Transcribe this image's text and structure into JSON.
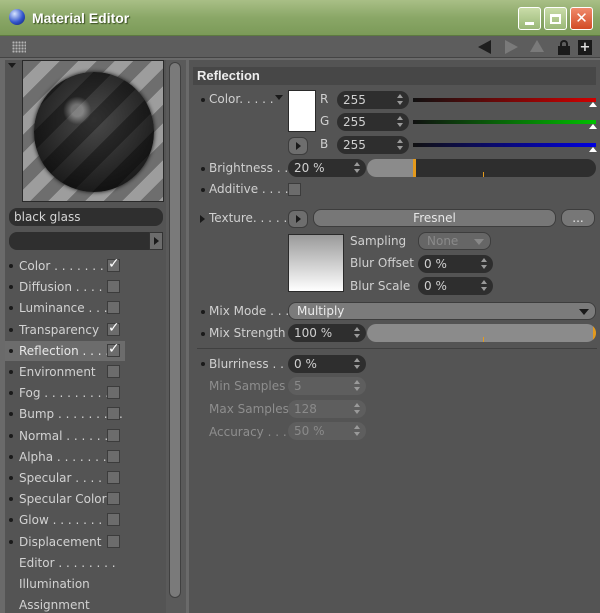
{
  "window": {
    "title": "Material Editor"
  },
  "channels": [
    {
      "label": "Color . . . . . . . .",
      "checkbox": true,
      "checked": true,
      "dot": true
    },
    {
      "label": "Diffusion . . . . . .",
      "checkbox": true,
      "checked": false,
      "dot": true
    },
    {
      "label": "Luminance . . . .",
      "checkbox": true,
      "checked": false,
      "dot": true
    },
    {
      "label": "Transparency",
      "checkbox": true,
      "checked": true,
      "dot": true
    },
    {
      "label": "Reflection . . . . .",
      "checkbox": true,
      "checked": true,
      "dot": true,
      "active": true
    },
    {
      "label": "Environment",
      "checkbox": true,
      "checked": false,
      "dot": true
    },
    {
      "label": "Fog . . . . . . . . . .",
      "checkbox": true,
      "checked": false,
      "dot": true
    },
    {
      "label": "Bump . . . . . . . . .",
      "checkbox": true,
      "checked": false,
      "dot": true
    },
    {
      "label": "Normal . . . . . . .",
      "checkbox": true,
      "checked": false,
      "dot": true
    },
    {
      "label": "Alpha . . . . . . . .",
      "checkbox": true,
      "checked": false,
      "dot": true
    },
    {
      "label": "Specular . . . . .",
      "checkbox": true,
      "checked": false,
      "dot": true
    },
    {
      "label": "Specular Color",
      "checkbox": true,
      "checked": false,
      "dot": true
    },
    {
      "label": "Glow . . . . . . . . .",
      "checkbox": true,
      "checked": false,
      "dot": true
    },
    {
      "label": "Displacement",
      "checkbox": true,
      "checked": false,
      "dot": true
    },
    {
      "label": "Editor . . . . . . . .",
      "checkbox": false,
      "checked": false,
      "dot": false
    },
    {
      "label": "Illumination",
      "checkbox": false,
      "checked": false,
      "dot": false
    },
    {
      "label": "Assignment",
      "checkbox": false,
      "checked": false,
      "dot": false
    }
  ],
  "material_name": "black glass",
  "reflection": {
    "header": "Reflection",
    "color_label": "Color. . . . .",
    "r_label": "R",
    "g_label": "G",
    "b_label": "B",
    "r_value": "255",
    "g_value": "255",
    "b_value": "255",
    "brightness_label": "Brightness . .",
    "brightness_value": "20 %",
    "brightness_level": 0.2,
    "additive_label": "Additive . . . .",
    "texture_label": "Texture. . . . .",
    "texture_name": "Fresnel",
    "more_label": "...",
    "sampling_label": "Sampling",
    "sampling_value": "None",
    "blur_offset_label": "Blur Offset",
    "blur_offset_value": "0 %",
    "blur_scale_label": "Blur Scale",
    "blur_scale_value": "0 %",
    "mix_mode_label": "Mix Mode . . .",
    "mix_mode_value": "Multiply",
    "mix_strength_label": "Mix Strength",
    "mix_strength_value": "100 %",
    "mix_strength_level": 1.0,
    "blurriness_label": "Blurriness . . .",
    "blurriness_value": "0 %",
    "min_samples_label": "Min Samples",
    "min_samples_value": "5",
    "max_samples_label": "Max Samples",
    "max_samples_value": "128",
    "accuracy_label": "Accuracy . . .",
    "accuracy_value": "50 %"
  },
  "colors": {
    "accent": "#e49a1c",
    "red": "#d00000",
    "green": "#00c000",
    "blue": "#0000e0"
  }
}
